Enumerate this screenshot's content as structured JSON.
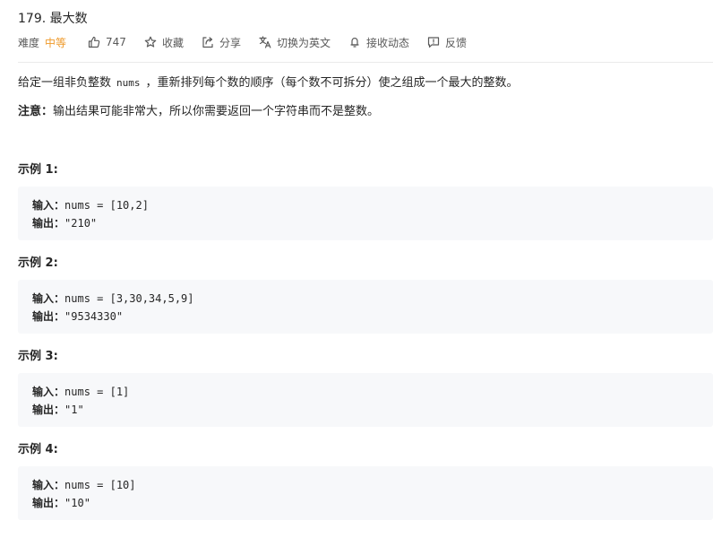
{
  "problem": {
    "title": "179. 最大数",
    "difficulty_label": "难度",
    "difficulty_value": "中等",
    "likes": "747",
    "actions": {
      "favorite": "收藏",
      "share": "分享",
      "switch_lang": "切换为英文",
      "notify": "接收动态",
      "feedback": "反馈"
    }
  },
  "description": {
    "before_code": "给定一组非负整数",
    "code": "nums",
    "after_code": "，重新排列每个数的顺序（每个数不可拆分）使之组成一个最大的整数。",
    "note_label": "注意：",
    "note_text": "输出结果可能非常大，所以你需要返回一个字符串而不是整数。"
  },
  "examples": [
    {
      "title": "示例 1:",
      "input_label": "输入：",
      "input": "nums = [10,2]",
      "output_label": "输出：",
      "output": "\"210\""
    },
    {
      "title": "示例 2:",
      "input_label": "输入：",
      "input": "nums = [3,30,34,5,9]",
      "output_label": "输出：",
      "output": "\"9534330\""
    },
    {
      "title": "示例 3:",
      "input_label": "输入：",
      "input": "nums = [1]",
      "output_label": "输出：",
      "output": "\"1\""
    },
    {
      "title": "示例 4:",
      "input_label": "输入：",
      "input": "nums = [10]",
      "output_label": "输出：",
      "output": "\"10\""
    }
  ],
  "colors": {
    "difficulty_medium": "#ef9a2b",
    "code_block_bg": "#f7f8fa",
    "text": "#262626",
    "muted": "#595959"
  },
  "icons": [
    "thumb-up-icon",
    "star-icon",
    "share-icon",
    "translate-icon",
    "bell-icon",
    "feedback-icon"
  ]
}
